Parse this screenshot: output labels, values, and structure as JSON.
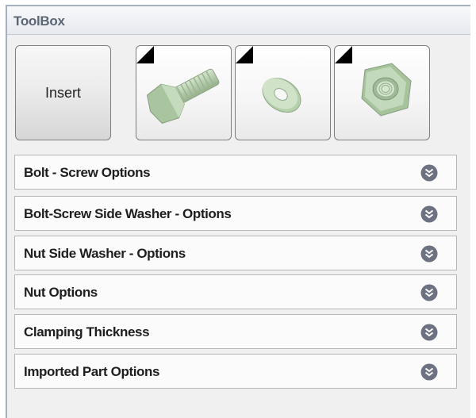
{
  "toolbox": {
    "title": "ToolBox",
    "insert_label": "Insert",
    "part_buttons": [
      {
        "icon": "bolt-icon"
      },
      {
        "icon": "washer-icon"
      },
      {
        "icon": "nut-icon"
      }
    ],
    "options": [
      {
        "label": "Bolt - Screw Options"
      },
      {
        "label": "Bolt-Screw Side Washer - Options"
      },
      {
        "label": "Nut Side Washer - Options"
      },
      {
        "label": "Nut Options"
      },
      {
        "label": "Clamping Thickness"
      },
      {
        "label": "Imported Part Options"
      }
    ]
  },
  "colors": {
    "part_green": "#b9d3b0",
    "chevron_bg": "#6d7283"
  }
}
